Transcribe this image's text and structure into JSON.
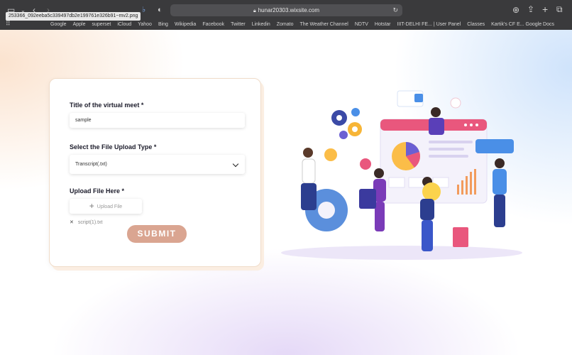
{
  "browser": {
    "tab_tooltip": "253366_092eeba5c339497db2e199761e326b91~mv2.png",
    "url": "hunar20303.wixsite.com",
    "bookmarks": [
      "Google",
      "Apple",
      "superset",
      "iCloud",
      "Yahoo",
      "Bing",
      "Wikipedia",
      "Facebook",
      "Twitter",
      "Linkedin",
      "Zomato",
      "The Weather Channel",
      "NDTV",
      "Hotstar",
      "IIIT-DELHI FE... | User Panel",
      "Classes",
      "Kartik's CF E... Google Docs"
    ]
  },
  "form": {
    "title_label": "Title of the virtual meet *",
    "title_value": "sample",
    "type_label": "Select the File Upload Type *",
    "type_value": "Transcript(.txt)",
    "upload_label": "Upload File Here *",
    "upload_button": "Upload File",
    "file_name": "script(1).txt",
    "submit": "SUBMIT"
  },
  "colors": {
    "submit": "#daa591",
    "chrome": "#3a3a3c"
  }
}
